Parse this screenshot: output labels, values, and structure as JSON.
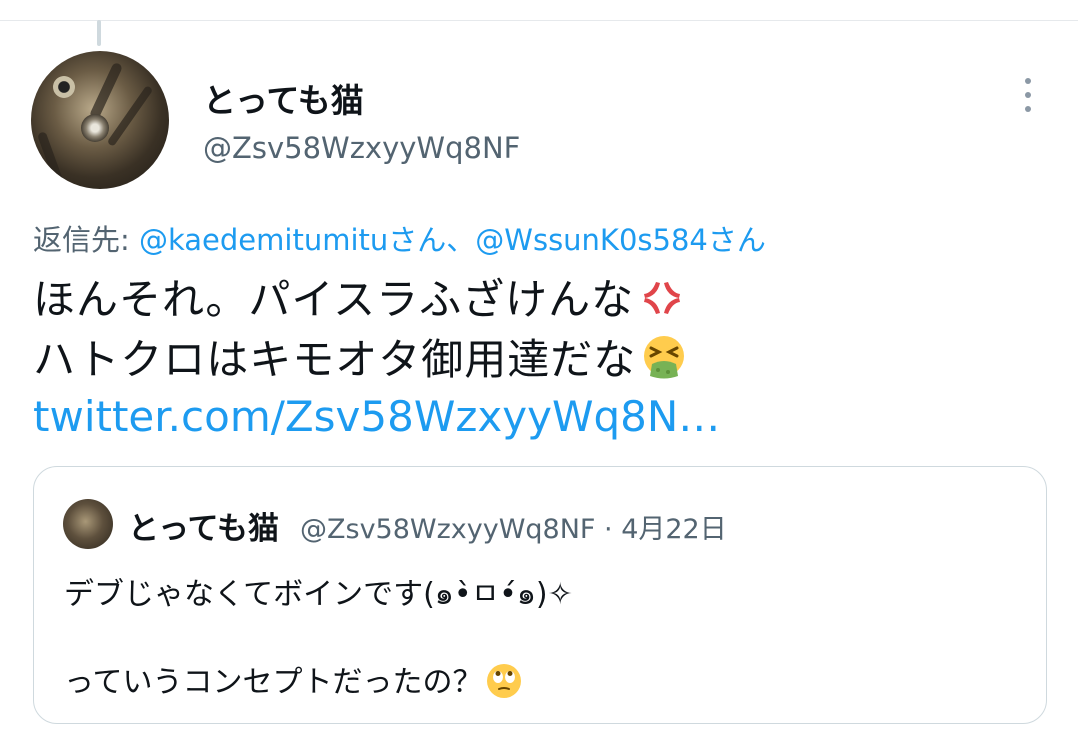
{
  "tweet": {
    "display_name": "とっても猫",
    "handle": "@Zsv58WzxyyWq8NF",
    "reply_prefix": "返信先:",
    "reply_to_1": "@kaedemitumituさん",
    "reply_sep": "、",
    "reply_to_2": "@WssunK0s584さん",
    "text_line1": "ほんそれ。パイスラふざけんな",
    "text_line2": "ハトクロはキモオタ御用達だな",
    "link": "twitter.com/Zsv58WzxyyWq8N…",
    "emoji_1": "anger-symbol",
    "emoji_2": "vomiting-face"
  },
  "quoted_tweet": {
    "display_name": "とっても猫",
    "handle_date": "@Zsv58WzxyyWq8NF · 4月22日",
    "text_line1": "デブじゃなくてボインです(๑•̀ㅁ•́๑)✧",
    "text_line2": "っていうコンセプトだったの？",
    "emoji": "face-with-rolling-eyes"
  },
  "colors": {
    "link": "#1d9bf0",
    "secondary_text": "#536471",
    "primary_text": "#0f1419",
    "border": "#cfd9de"
  }
}
